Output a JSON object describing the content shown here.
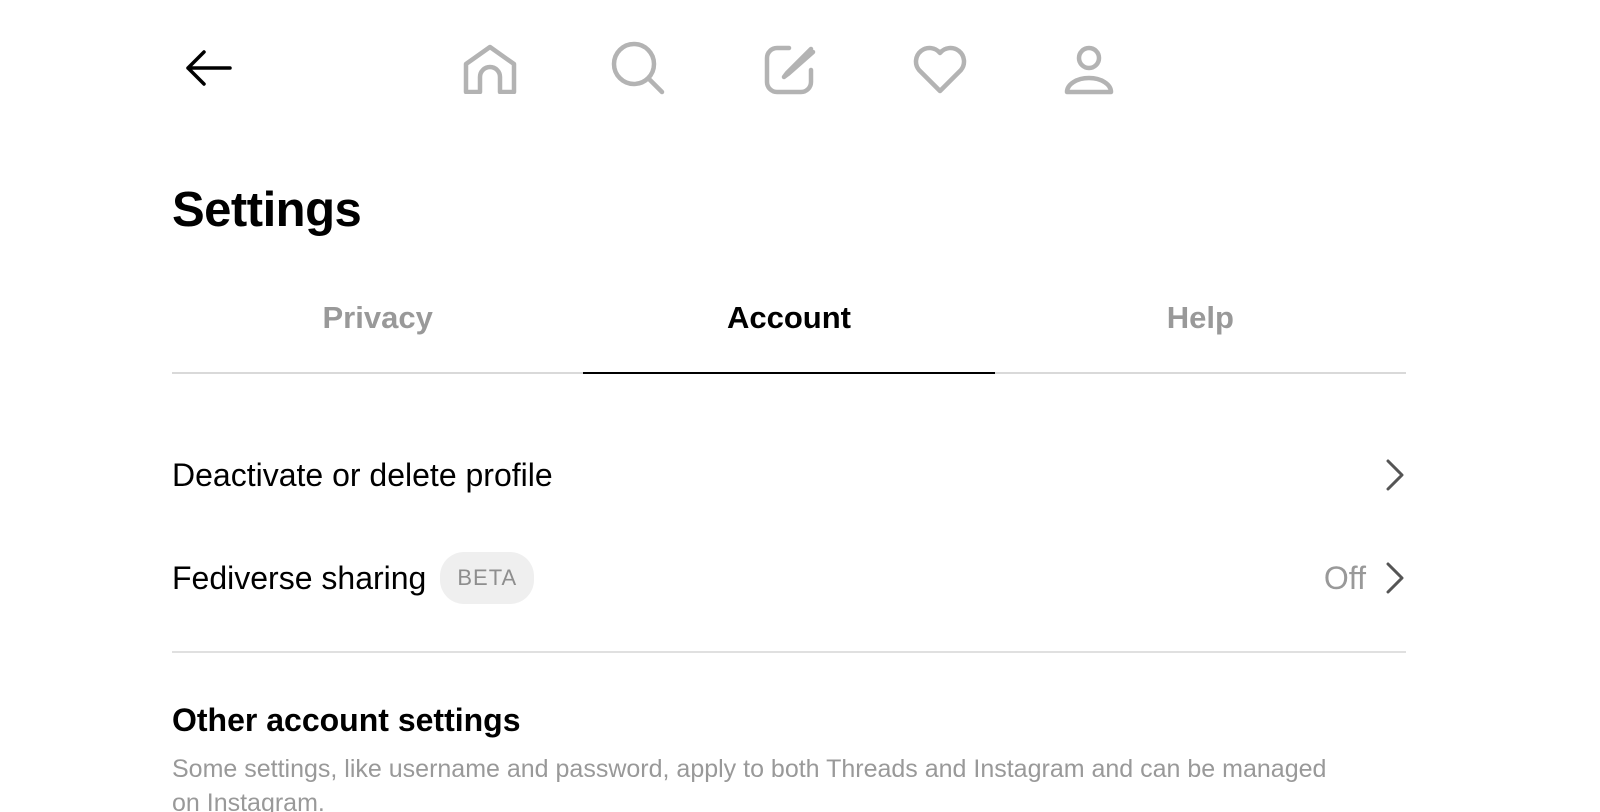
{
  "nav": {
    "back_icon": "arrow-left-icon",
    "items": [
      {
        "icon": "home-icon"
      },
      {
        "icon": "search-icon"
      },
      {
        "icon": "compose-icon"
      },
      {
        "icon": "heart-icon"
      },
      {
        "icon": "profile-icon"
      }
    ],
    "icon_color": "#b3b3b3"
  },
  "page": {
    "title": "Settings"
  },
  "tabs": [
    {
      "label": "Privacy",
      "active": false
    },
    {
      "label": "Account",
      "active": true
    },
    {
      "label": "Help",
      "active": false
    }
  ],
  "rows": [
    {
      "label": "Deactivate or delete profile",
      "icon": "chevron-right-icon"
    },
    {
      "label": "Fediverse sharing",
      "badge": "BETA",
      "value": "Off",
      "icon": "chevron-right-icon"
    }
  ],
  "other_section": {
    "heading": "Other account settings",
    "description": "Some settings, like username and password, apply to both Threads and Instagram and can be managed on Instagram."
  }
}
